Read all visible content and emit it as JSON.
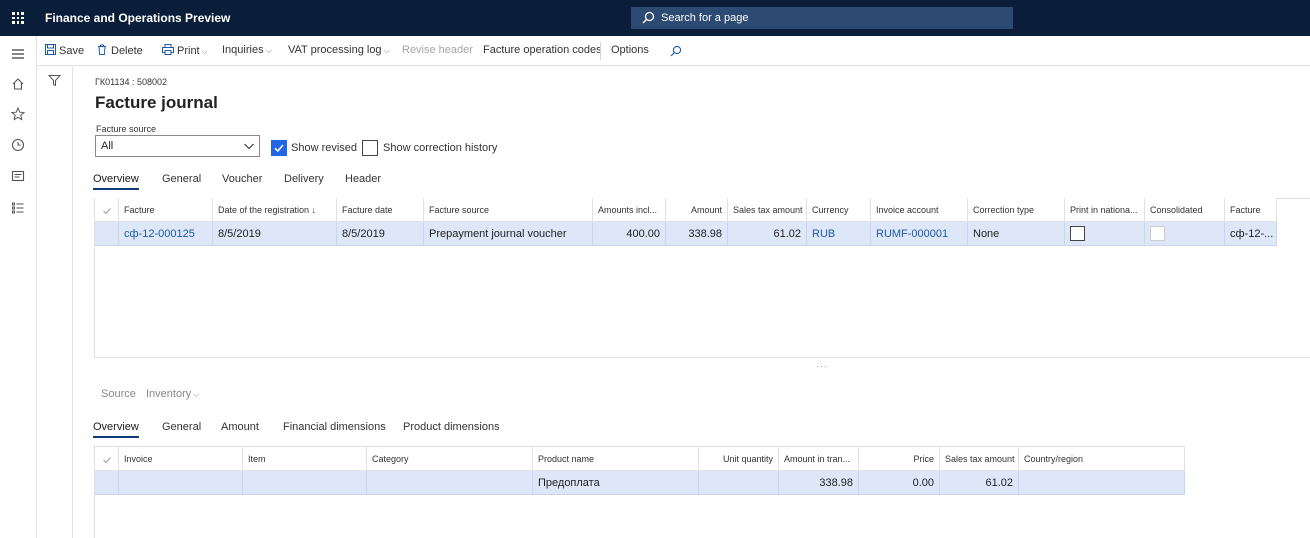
{
  "app": {
    "title": "Finance and Operations Preview",
    "search_placeholder": "Search for a page"
  },
  "actions": {
    "save": "Save",
    "delete": "Delete",
    "print": "Print",
    "inquiries": "Inquiries",
    "vat_log": "VAT processing log",
    "revise_header": "Revise header",
    "facture_codes": "Facture operation codes",
    "options": "Options"
  },
  "page": {
    "breadcrumb": "ГК01134 : 508002",
    "title": "Facture journal",
    "facture_source_label": "Facture source",
    "facture_source_value": "All",
    "show_revised": "Show revised",
    "show_correction_history": "Show correction history"
  },
  "tabs1": [
    "Overview",
    "General",
    "Voucher",
    "Delivery",
    "Header"
  ],
  "grid1": {
    "headers": [
      "Facture",
      "Date of the registration ↓",
      "Facture date",
      "Facture source",
      "Amounts incl...",
      "Amount",
      "Sales tax amount",
      "Currency",
      "Invoice account",
      "Correction type",
      "Print in nationa...",
      "Consolidated",
      "Facture"
    ],
    "row": [
      "сф-12-000125",
      "8/5/2019",
      "8/5/2019",
      "Prepayment journal voucher",
      "400.00",
      "338.98",
      "61.02",
      "RUB",
      "RUMF-000001",
      "None",
      "",
      "",
      "сф-12-..."
    ]
  },
  "sub_actions": {
    "source": "Source",
    "inventory": "Inventory"
  },
  "tabs2": [
    "Overview",
    "General",
    "Amount",
    "Financial dimensions",
    "Product dimensions"
  ],
  "grid2": {
    "headers": [
      "Invoice",
      "Item",
      "Category",
      "Product name",
      "Unit quantity",
      "Amount in tran...",
      "Price",
      "Sales tax amount",
      "Country/region"
    ],
    "row": [
      "",
      "",
      "",
      "Предоплата",
      "",
      "338.98",
      "0.00",
      "61.02",
      ""
    ]
  }
}
